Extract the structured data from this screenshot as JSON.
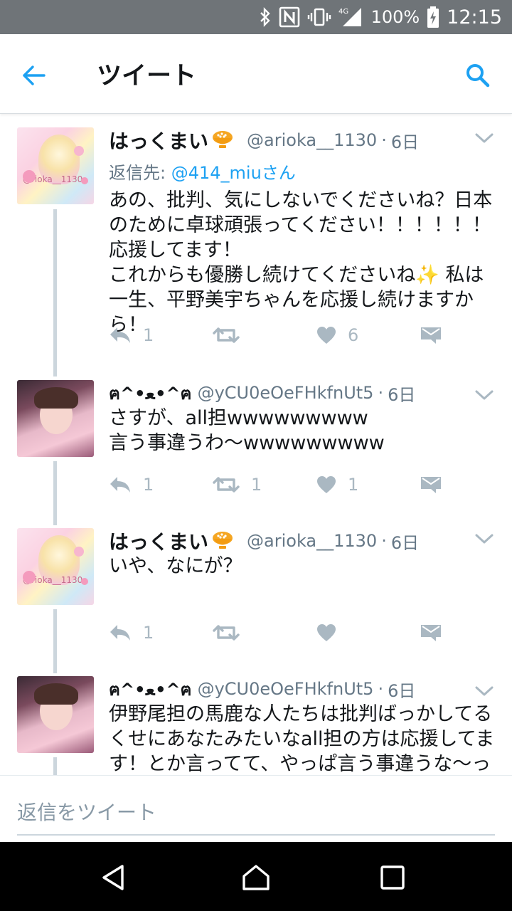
{
  "status_bar": {
    "network": "4G",
    "battery_percent": "100%",
    "time": "12:15",
    "icons": [
      "bluetooth-icon",
      "nfc-icon",
      "vibrate-icon",
      "signal-icon",
      "battery-charging-icon"
    ]
  },
  "app_bar": {
    "title": "ツイート",
    "back_icon": "arrow-left-icon",
    "search_icon": "search-icon"
  },
  "tweets": [
    {
      "name": "はっくまい",
      "badge_icon": "rice-bowl-emoji",
      "handle": "@arioka__1130",
      "time": "6日",
      "reply_to_label": "返信先:",
      "reply_to_user": "@414_miuさん",
      "text": "あの、批判、気にしないでくださいね？日本のために卓球頑張ってください！！！！！！応援してます！\nこれからも優勝し続けてくださいね✨ 私は一生、平野美宇ちゃんを応援し続けますから！",
      "reply_count": "1",
      "retweet_count": "",
      "like_count": "6"
    },
    {
      "name": "ฅ^•ﻌ•^ฅ",
      "handle": "@yCU0eOeFHkfnUt5",
      "time": "6日",
      "text": "さすが、all担wwwwwwwww\n言う事違うわ〜wwwwwwwww",
      "reply_count": "1",
      "retweet_count": "1",
      "like_count": "1"
    },
    {
      "name": "はっくまい",
      "badge_icon": "rice-bowl-emoji",
      "handle": "@arioka__1130",
      "time": "6日",
      "text": "いや、なにが？",
      "reply_count": "1",
      "retweet_count": "",
      "like_count": ""
    },
    {
      "name": "ฅ^•ﻌ•^ฅ",
      "handle": "@yCU0eOeFHkfnUt5",
      "time": "6日",
      "text": "伊野尾担の馬鹿な人たちは批判ばっかしてるくせにあなたみたいなall担の方は応援してます！とか言ってて、やっぱ言う事違うな〜って思っただけ"
    }
  ],
  "avatar_watermark": "@rioka__1130",
  "reply_bar": {
    "placeholder": "返信をツイート"
  },
  "colors": {
    "accent": "#1da1f2",
    "status_bar_bg": "#6f7478",
    "secondary_text": "#657786",
    "action_icon": "#aab8c2",
    "thread_line": "#ccd6dd"
  }
}
